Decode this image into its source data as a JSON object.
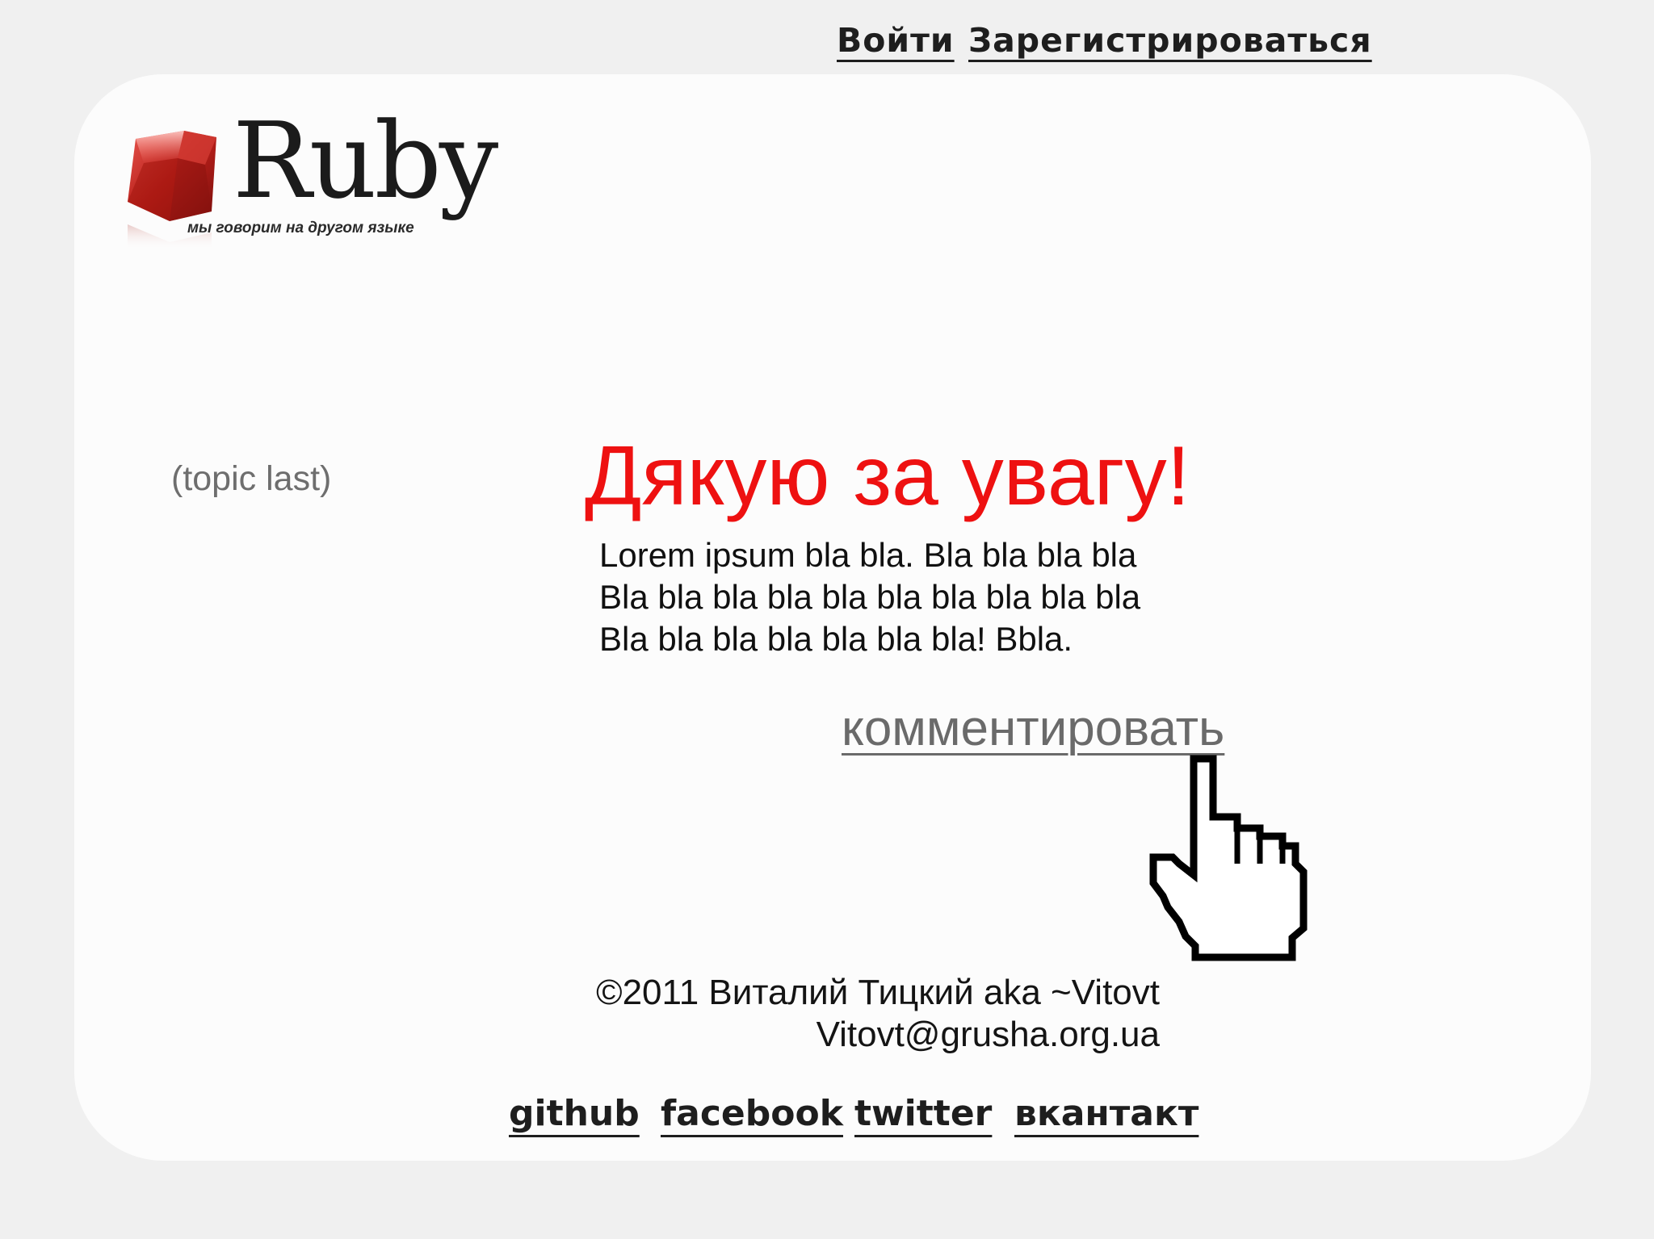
{
  "header": {
    "login_label": "Войти",
    "register_label": "Зарегистрироваться"
  },
  "logo": {
    "word": "Ruby",
    "tagline": "мы говорим на другом языке"
  },
  "sidebar": {
    "topic_label": "(topic last)"
  },
  "main": {
    "headline": "Дякую за увагу!",
    "body_lines": [
      "Lorem ipsum bla bla. Bla bla bla bla",
      "Bla bla bla bla bla bla bla bla bla bla",
      "Bla bla bla bla bla bla bla! Bbla."
    ],
    "comment_label": "комментировать"
  },
  "footer": {
    "copyright": "©2011 Виталий Тицкий aka ~Vitovt",
    "email": "Vitovt@grusha.org.ua",
    "social_links": [
      "github",
      "facebook",
      "twitter",
      "вкантакт"
    ]
  },
  "colors": {
    "headline": "#ee1111",
    "background": "#f0f0f0",
    "card": "#fcfcfc",
    "ruby_gem": "#b81f1a"
  },
  "icons": {
    "logo": "ruby-gem-icon",
    "cursor": "hand-pointer-icon"
  }
}
